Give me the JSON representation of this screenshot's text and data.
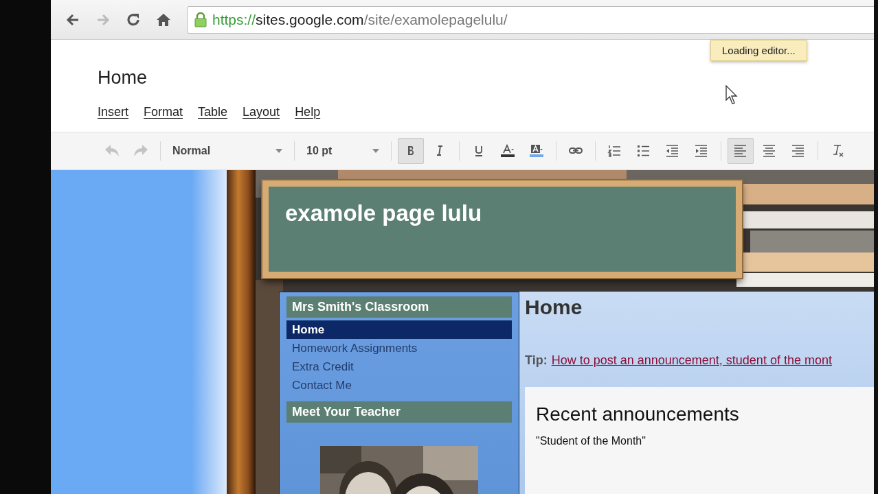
{
  "browser": {
    "back": {
      "disabled": false
    },
    "forward": {
      "disabled": true
    },
    "url": {
      "scheme": "https://",
      "host": "sites.google.com",
      "path": "/site/examolepagelulu/"
    }
  },
  "page_title": "Home",
  "menu": [
    "Insert",
    "Format",
    "Table",
    "Layout",
    "Help"
  ],
  "toolbar": {
    "history": [
      {
        "kind": "undo",
        "disabled": true
      },
      {
        "kind": "redo",
        "disabled": true
      }
    ],
    "style": "Normal",
    "size": "10 pt",
    "buttons": [
      {
        "kind": "bold",
        "selected": true
      },
      {
        "kind": "italic",
        "selected": false
      },
      {
        "kind": "underline",
        "selected": false
      },
      {
        "kind": "text-color",
        "selected": false
      },
      {
        "kind": "highlight",
        "selected": false
      },
      {
        "kind": "link",
        "selected": false
      },
      {
        "kind": "numbered-list",
        "selected": false
      },
      {
        "kind": "bulleted-list",
        "selected": false
      },
      {
        "kind": "outdent",
        "selected": false
      },
      {
        "kind": "indent",
        "selected": false
      },
      {
        "kind": "align-left",
        "selected": true
      },
      {
        "kind": "align-center",
        "selected": false
      },
      {
        "kind": "align-right",
        "selected": false
      },
      {
        "kind": "clear-format",
        "selected": false
      }
    ]
  },
  "toast": "Loading editor...",
  "site": {
    "title": "examole page lulu",
    "sidebar": {
      "heading": "Mrs Smith's Classroom",
      "nav": [
        {
          "label": "Home",
          "selected": true
        },
        {
          "label": "Homework Assignments",
          "selected": false
        },
        {
          "label": "Extra Credit",
          "selected": false
        },
        {
          "label": "Contact Me",
          "selected": false
        }
      ],
      "teacher_heading": "Meet Your Teacher"
    },
    "main": {
      "heading": "Home",
      "tip_label": "Tip:",
      "tip_link": "How to post an announcement, student of the mont",
      "announcements": {
        "title": "Recent announcements",
        "items": [
          "\"Student of the Month\""
        ]
      }
    }
  }
}
